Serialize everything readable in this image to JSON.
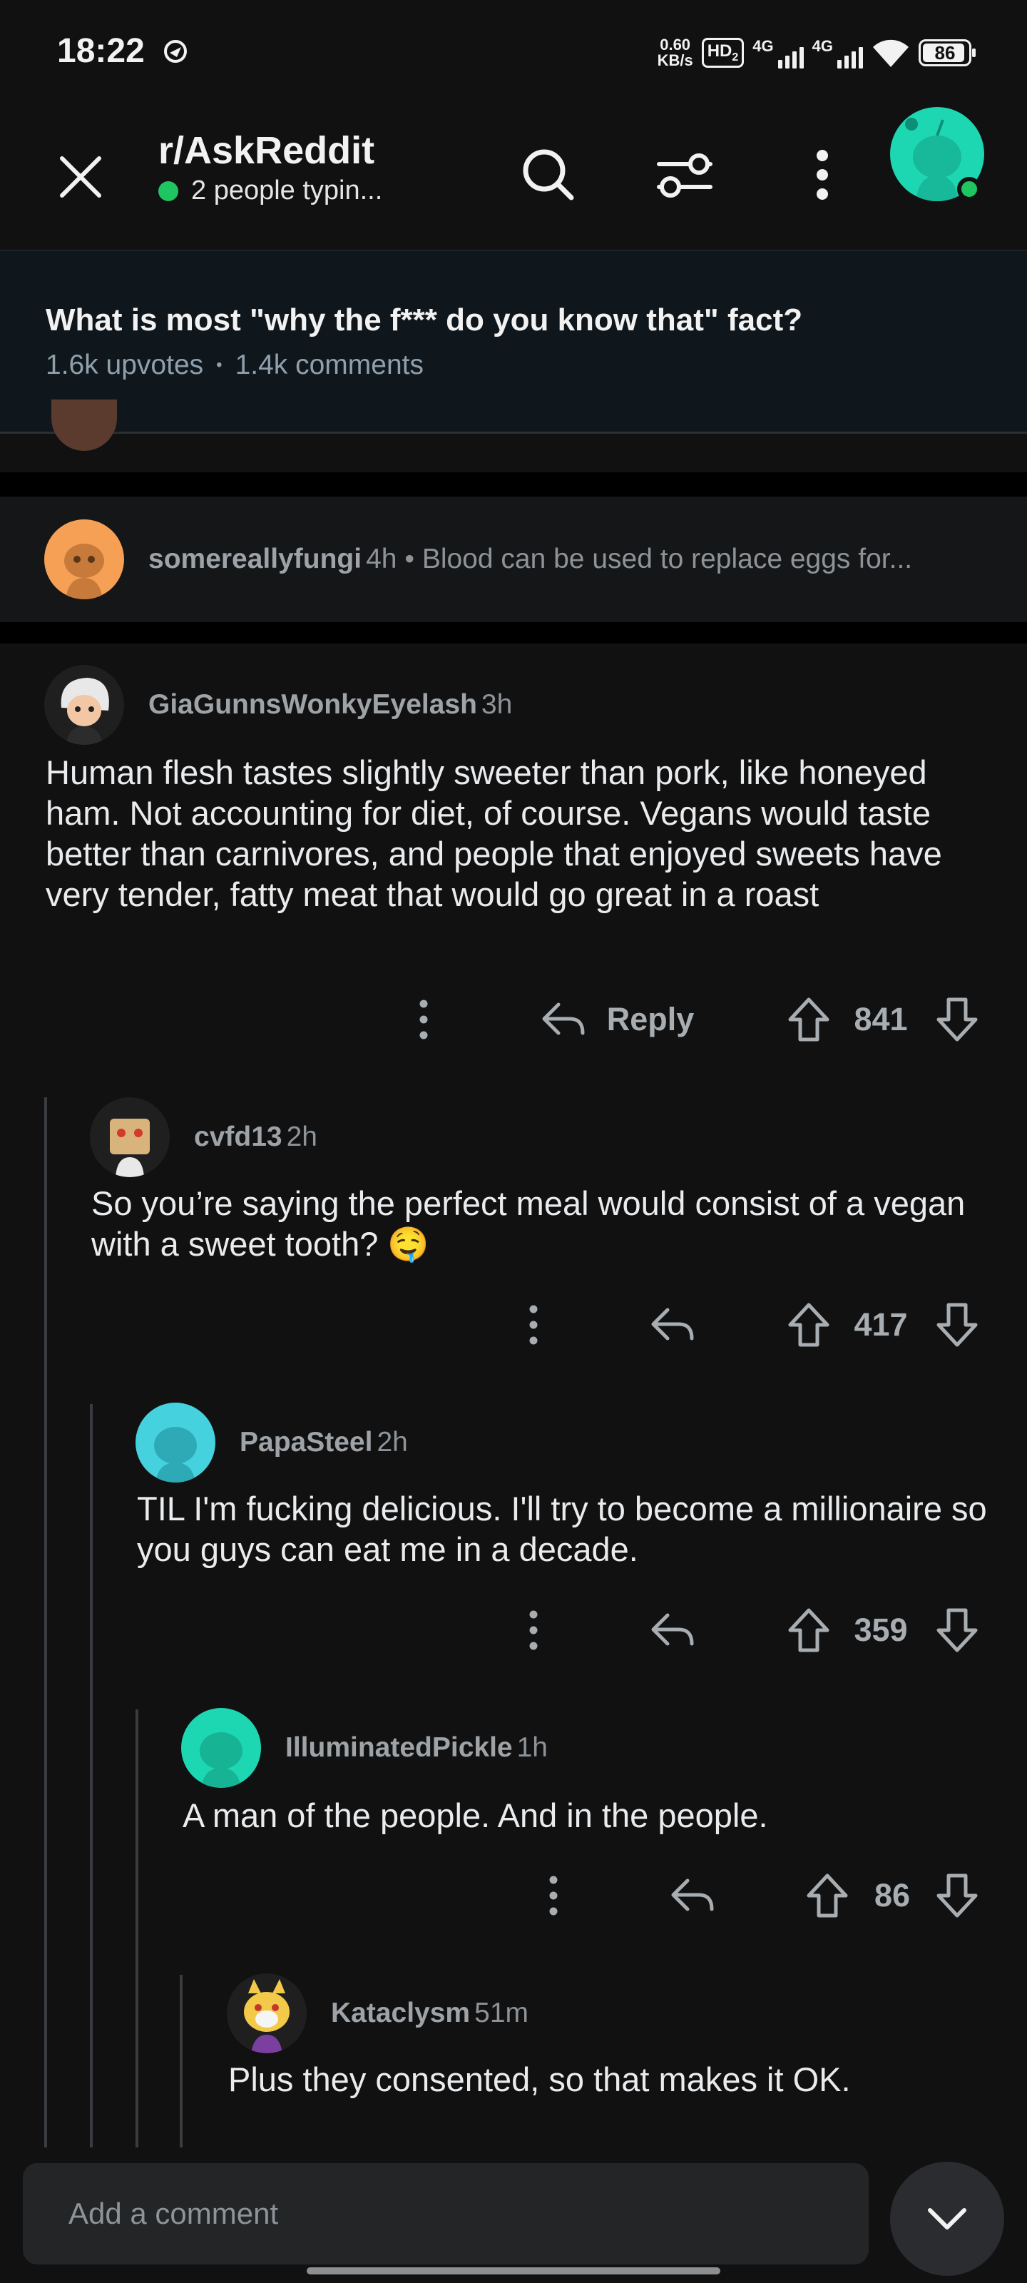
{
  "status_bar": {
    "time": "18:22",
    "net_speed_value": "0.60",
    "net_speed_unit": "KB/s",
    "hd_badge": "HD",
    "hd_sub": "2",
    "sim1_label": "4G",
    "sim2_label": "4G",
    "battery": "86"
  },
  "header": {
    "subreddit": "r/AskReddit",
    "typing_status": "2 people typin..."
  },
  "post": {
    "title": "What is most \"why the f*** do you know that\" fact?",
    "upvotes": "1.6k upvotes",
    "separator": "•",
    "comments": "1.4k comments"
  },
  "collapsed_comment": {
    "username": "somereallyfungi",
    "age": "4h",
    "preview": "• Blood can be used to replace eggs for..."
  },
  "comments": [
    {
      "username": "GiaGunnsWonkyEyelash",
      "age": "3h",
      "body": "Human flesh tastes slightly sweeter than pork, like honeyed ham. Not accounting for diet, of course. Vegans  would taste better than carnivores, and people that enjoyed sweets have very tender, fatty meat that would go great in a roast",
      "reply_label": "Reply",
      "score": "841"
    },
    {
      "username": "cvfd13",
      "age": "2h",
      "body": "So you’re saying the perfect meal would consist of a vegan with a sweet tooth? 🤤",
      "score": "417"
    },
    {
      "username": "PapaSteel",
      "age": "2h",
      "body": "TIL I'm fucking delicious. I'll try to become a millionaire so you guys can eat me in a decade.",
      "score": "359"
    },
    {
      "username": "IlluminatedPickle",
      "age": "1h",
      "body": "A man of the people. And in the people.",
      "score": "86"
    },
    {
      "username": "Kataclysm",
      "age": "51m",
      "body": "Plus they consented, so that makes it OK."
    }
  ],
  "composer": {
    "placeholder": "Add a comment"
  },
  "colors": {
    "background": "#111112",
    "post_bar": "#10171c",
    "online_green": "#1fc560",
    "avatar_teal": "#1dd7b3",
    "avatar_cyan": "#46d1df",
    "avatar_orange": "#f6a055"
  }
}
